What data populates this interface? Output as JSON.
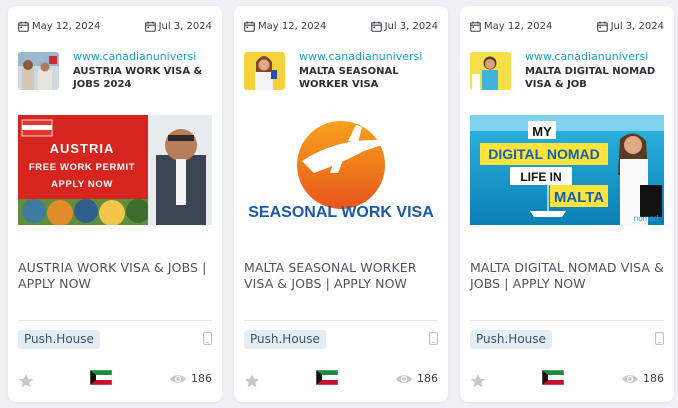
{
  "cards": [
    {
      "date_start": "May 12, 2024",
      "date_end": "Jul 3, 2024",
      "site": "www.canadianuniversi",
      "title": "AUSTRIA WORK VISA & JOBS 2024",
      "description": "AUSTRIA WORK VISA & JOBS | APPLY NOW",
      "banner_lines": [
        "AUSTRIA",
        "FREE WORK PERMIT",
        "APPLY NOW"
      ],
      "network": "Push.House",
      "views": "186",
      "country_flag": "kuwait-flag",
      "device": "mobile-icon"
    },
    {
      "date_start": "May 12, 2024",
      "date_end": "Jul 3, 2024",
      "site": "www.canadianuniversi",
      "title": "MALTA SEASONAL WORKER VISA",
      "description": "MALTA SEASONAL WORKER VISA & JOBS | APPLY NOW",
      "banner_lines": [
        "SEASONAL WORK VISA"
      ],
      "network": "Push.House",
      "views": "186",
      "country_flag": "kuwait-flag",
      "device": "mobile-icon"
    },
    {
      "date_start": "May 12, 2024",
      "date_end": "Jul 3, 2024",
      "site": "www.canadianuniversi",
      "title": "MALTA DIGITAL NOMAD VISA & JOB",
      "description": "MALTA DIGITAL NOMAD VISA & JOBS | APPLY NOW",
      "banner_lines": [
        "MY",
        "DIGITAL NOMAD",
        "LIFE IN",
        "MALTA",
        "nomad"
      ],
      "network": "Push.House",
      "views": "186",
      "country_flag": "kuwait-flag",
      "device": "mobile-icon"
    }
  ],
  "colors": {
    "accent": "#1aa0c8",
    "tag_bg": "#e3edf3",
    "page_bg": "#eef1f5"
  }
}
